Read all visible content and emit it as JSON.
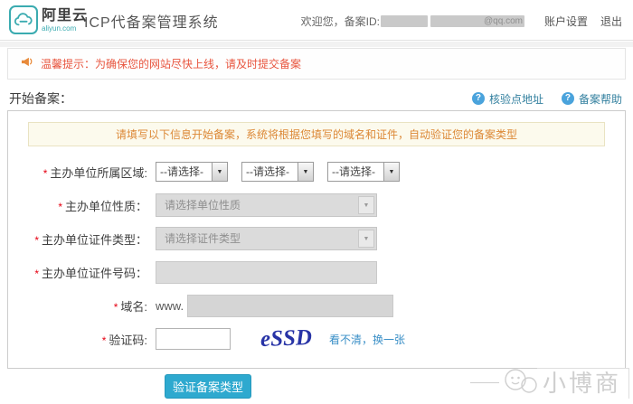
{
  "header": {
    "brand": "阿里云",
    "brand_domain": "aliyun.com",
    "title": "ICP代备案管理系统",
    "welcome_prefix": "欢迎您，备案ID:",
    "masked_email_hint": "@qq.com",
    "account_settings": "账户设置",
    "logout": "退出"
  },
  "notice": {
    "text": "温馨提示：为确保您的网站尽快上线，请及时提交备案"
  },
  "page": {
    "heading": "开始备案：",
    "links": [
      {
        "label": "核验点地址",
        "icon": "help-icon",
        "icon_glyph": "?"
      },
      {
        "label": "备案帮助",
        "icon": "help-icon",
        "icon_glyph": "?"
      }
    ]
  },
  "form": {
    "required_mark": "*",
    "tip": "请填写以下信息开始备案，系统将根据您填写的域名和证件，自动验证您的备案类型",
    "region": {
      "label": "主办单位所属区域:",
      "selects": [
        "--请选择-",
        "--请选择-",
        "--请选择-"
      ],
      "arrow": "▼"
    },
    "org_nature": {
      "label": "主办单位性质：",
      "placeholder": "请选择单位性质",
      "arrow": "▼"
    },
    "cert_type": {
      "label": "主办单位证件类型：",
      "placeholder": "请选择证件类型",
      "arrow": "▼"
    },
    "cert_number": {
      "label": "主办单位证件号码：",
      "value": ""
    },
    "domain": {
      "label": "域名:",
      "prefix": "www.",
      "value": ""
    },
    "captcha": {
      "label": "验证码:",
      "value": "",
      "image_text": "eSSD",
      "refresh_label": "看不清，换一张"
    }
  },
  "submit_label": "验证备案类型",
  "watermark": {
    "text": "小博商"
  },
  "colors": {
    "brand_teal": "#3aabb0",
    "link_blue": "#3a8fc7",
    "notice_red": "#e8553f",
    "tip_orange": "#dc8836",
    "button_cyan": "#2ea9cf",
    "captcha_navy": "#2733a6"
  }
}
